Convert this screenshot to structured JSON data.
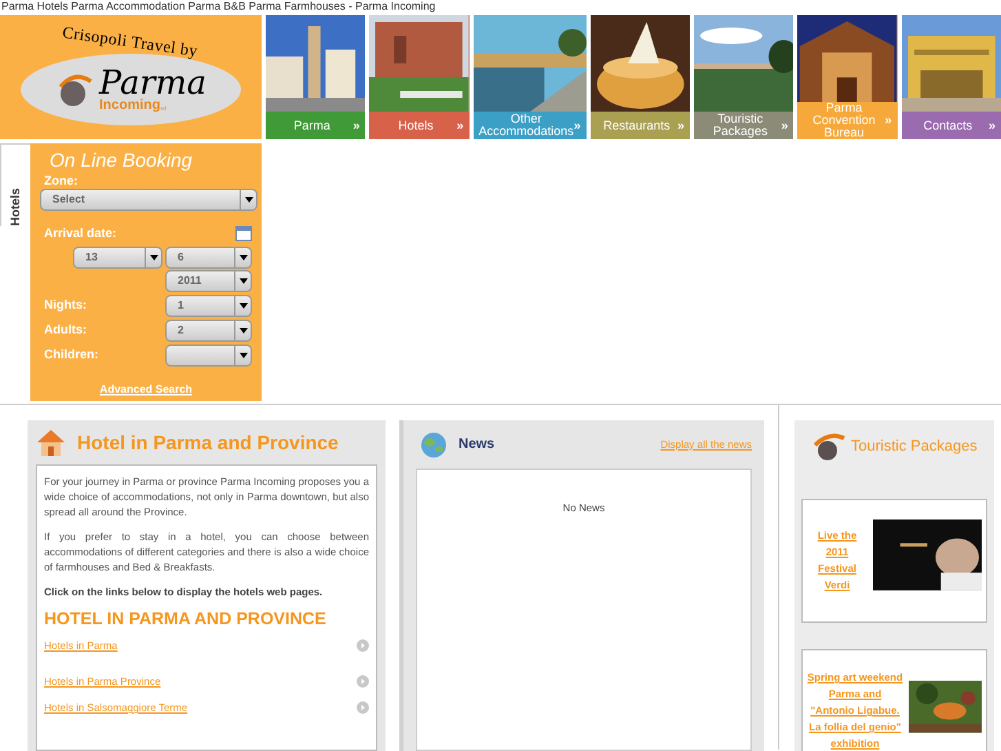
{
  "page_title": "Parma Hotels Parma Accommodation Parma B&B Parma Farmhouses - Parma Incoming",
  "logo": {
    "arc_text": "Crisopoli Travel by",
    "brand": "Parma",
    "sub": "Incoming",
    "suffix": "srl"
  },
  "nav": [
    {
      "label": "Parma",
      "arrow": "»",
      "color": "#3f9a37",
      "kind": "city"
    },
    {
      "label": "Hotels",
      "arrow": "»",
      "color": "#d8614a",
      "kind": "brick"
    },
    {
      "label": "Other Accommodations",
      "arrow": "»",
      "color": "#3b9fc6",
      "kind": "river"
    },
    {
      "label": "Restaurants",
      "arrow": "»",
      "color": "#a9a052",
      "kind": "cheese"
    },
    {
      "label": "Touristic Packages",
      "arrow": "»",
      "color": "#8b8b78",
      "kind": "field"
    },
    {
      "label": "Parma Convention Bureau",
      "arrow": "»",
      "color": "#f7a83a",
      "kind": "hall"
    },
    {
      "label": "Contacts",
      "arrow": "»",
      "color": "#9b6bb0",
      "kind": "theatre"
    }
  ],
  "side_tab": "Hotels",
  "booking": {
    "title": "On Line Booking",
    "zone_label": "Zone:",
    "zone_value": "Select",
    "arrival_label": "Arrival date:",
    "day": "13",
    "month": "6",
    "year": "2011",
    "rows": [
      {
        "label": "Nights:",
        "value": "1"
      },
      {
        "label": "Adults:",
        "value": "2"
      },
      {
        "label": "Children:",
        "value": ""
      }
    ],
    "advanced": "Advanced Search"
  },
  "hotel": {
    "title": "Hotel in Parma and Province",
    "paragraphs": [
      "For your journey in Parma or province Parma Incoming proposes you a wide choice of accommodations, not only in Parma downtown, but also spread all around the Province.",
      "If you prefer to stay in a hotel, you can choose between accommodations of different categories and there is also a wide choice of farmhouses and Bed & Breakfasts."
    ],
    "instruction": "Click on the links below to display the hotels web pages.",
    "heading": "HOTEL IN PARMA AND PROVINCE",
    "links": [
      "Hotels in Parma",
      "Hotels in Parma Province",
      "Hotels in Salsomaggiore Terme"
    ]
  },
  "news": {
    "title": "News",
    "link": "Display all the news",
    "empty": "No News"
  },
  "packages": {
    "title": "Touristic Packages",
    "items": [
      {
        "text": "Live the 2011 Festival Verdi",
        "kind": "dark"
      },
      {
        "text": "Spring art weekend Parma and \"Antonio Ligabue. La follia del genio\" exhibition",
        "kind": "jungle"
      }
    ]
  }
}
